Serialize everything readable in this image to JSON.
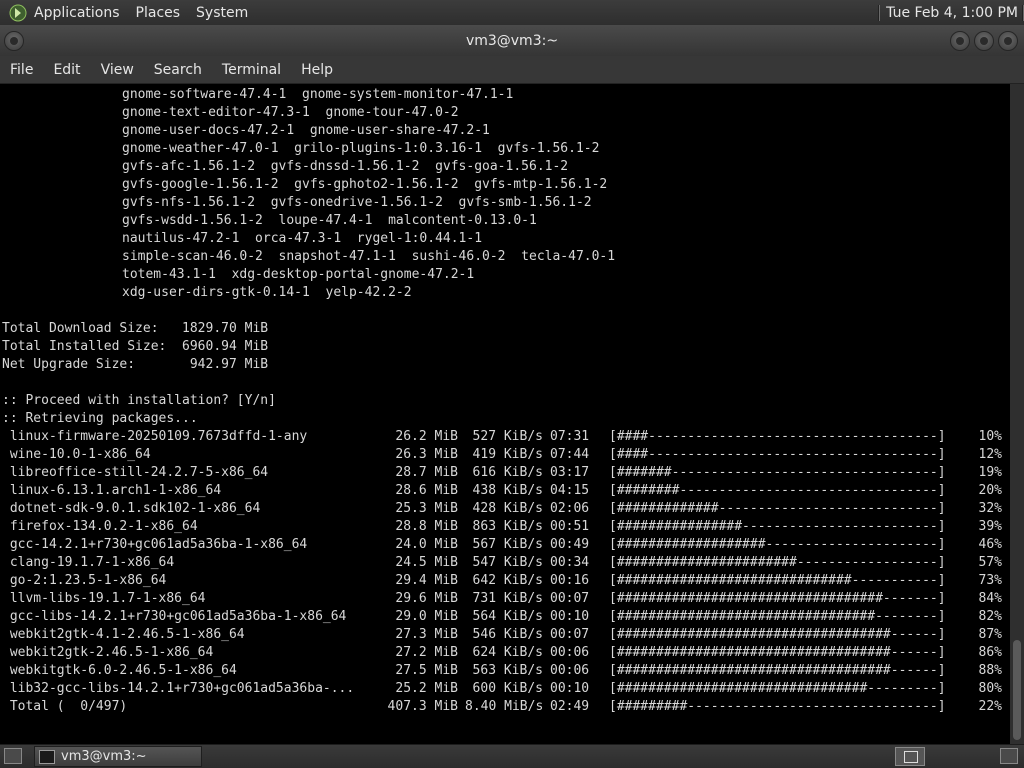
{
  "top_panel": {
    "menus": [
      "Applications",
      "Places",
      "System"
    ],
    "clock": "Tue Feb  4,  1:00 PM"
  },
  "window": {
    "title": "vm3@vm3:~",
    "menu": [
      "File",
      "Edit",
      "View",
      "Search",
      "Terminal",
      "Help"
    ]
  },
  "terminal": {
    "package_lines": [
      "gnome-software-47.4-1  gnome-system-monitor-47.1-1",
      "gnome-text-editor-47.3-1  gnome-tour-47.0-2",
      "gnome-user-docs-47.2-1  gnome-user-share-47.2-1",
      "gnome-weather-47.0-1  grilo-plugins-1:0.3.16-1  gvfs-1.56.1-2",
      "gvfs-afc-1.56.1-2  gvfs-dnssd-1.56.1-2  gvfs-goa-1.56.1-2",
      "gvfs-google-1.56.1-2  gvfs-gphoto2-1.56.1-2  gvfs-mtp-1.56.1-2",
      "gvfs-nfs-1.56.1-2  gvfs-onedrive-1.56.1-2  gvfs-smb-1.56.1-2",
      "gvfs-wsdd-1.56.1-2  loupe-47.4-1  malcontent-0.13.0-1",
      "nautilus-47.2-1  orca-47.3-1  rygel-1:0.44.1-1",
      "simple-scan-46.0-2  snapshot-47.1-1  sushi-46.0-2  tecla-47.0-1",
      "totem-43.1-1  xdg-desktop-portal-gnome-47.2-1",
      "xdg-user-dirs-gtk-0.14-1  yelp-42.2-2"
    ],
    "summary": [
      "Total Download Size:   1829.70 MiB",
      "Total Installed Size:  6960.94 MiB",
      "Net Upgrade Size:       942.97 MiB"
    ],
    "prompt": ":: Proceed with installation? [Y/n]",
    "retrieving": ":: Retrieving packages...",
    "downloads": [
      {
        "name": " linux-firmware-20250109.7673dffd-1-any",
        "size": "26.2 MiB",
        "speed": "527 KiB/s",
        "eta": "07:31",
        "bar": "[####-------------------------------------]",
        "pct": "10%"
      },
      {
        "name": " wine-10.0-1-x86_64",
        "size": "26.3 MiB",
        "speed": "419 KiB/s",
        "eta": "07:44",
        "bar": "[####-------------------------------------]",
        "pct": "12%"
      },
      {
        "name": " libreoffice-still-24.2.7-5-x86_64",
        "size": "28.7 MiB",
        "speed": "616 KiB/s",
        "eta": "03:17",
        "bar": "[#######----------------------------------]",
        "pct": "19%"
      },
      {
        "name": " linux-6.13.1.arch1-1-x86_64",
        "size": "28.6 MiB",
        "speed": "438 KiB/s",
        "eta": "04:15",
        "bar": "[########---------------------------------]",
        "pct": "20%"
      },
      {
        "name": " dotnet-sdk-9.0.1.sdk102-1-x86_64",
        "size": "25.3 MiB",
        "speed": "428 KiB/s",
        "eta": "02:06",
        "bar": "[#############----------------------------]",
        "pct": "32%"
      },
      {
        "name": " firefox-134.0.2-1-x86_64",
        "size": "28.8 MiB",
        "speed": "863 KiB/s",
        "eta": "00:51",
        "bar": "[################-------------------------]",
        "pct": "39%"
      },
      {
        "name": " gcc-14.2.1+r730+gc061ad5a36ba-1-x86_64",
        "size": "24.0 MiB",
        "speed": "567 KiB/s",
        "eta": "00:49",
        "bar": "[###################----------------------]",
        "pct": "46%"
      },
      {
        "name": " clang-19.1.7-1-x86_64",
        "size": "24.5 MiB",
        "speed": "547 KiB/s",
        "eta": "00:34",
        "bar": "[#######################------------------]",
        "pct": "57%"
      },
      {
        "name": " go-2:1.23.5-1-x86_64",
        "size": "29.4 MiB",
        "speed": "642 KiB/s",
        "eta": "00:16",
        "bar": "[##############################-----------]",
        "pct": "73%"
      },
      {
        "name": " llvm-libs-19.1.7-1-x86_64",
        "size": "29.6 MiB",
        "speed": "731 KiB/s",
        "eta": "00:07",
        "bar": "[##################################-------]",
        "pct": "84%"
      },
      {
        "name": " gcc-libs-14.2.1+r730+gc061ad5a36ba-1-x86_64",
        "size": "29.0 MiB",
        "speed": "564 KiB/s",
        "eta": "00:10",
        "bar": "[#################################--------]",
        "pct": "82%"
      },
      {
        "name": " webkit2gtk-4.1-2.46.5-1-x86_64",
        "size": "27.3 MiB",
        "speed": "546 KiB/s",
        "eta": "00:07",
        "bar": "[###################################------]",
        "pct": "87%"
      },
      {
        "name": " webkit2gtk-2.46.5-1-x86_64",
        "size": "27.2 MiB",
        "speed": "624 KiB/s",
        "eta": "00:06",
        "bar": "[###################################------]",
        "pct": "86%"
      },
      {
        "name": " webkitgtk-6.0-2.46.5-1-x86_64",
        "size": "27.5 MiB",
        "speed": "563 KiB/s",
        "eta": "00:06",
        "bar": "[###################################------]",
        "pct": "88%"
      },
      {
        "name": " lib32-gcc-libs-14.2.1+r730+gc061ad5a36ba-...",
        "size": "25.2 MiB",
        "speed": "600 KiB/s",
        "eta": "00:10",
        "bar": "[################################---------]",
        "pct": "80%"
      },
      {
        "name": " Total (  0/497)",
        "size": "407.3 MiB",
        "speed": "8.40 MiB/s",
        "eta": "02:49",
        "bar": "[#########--------------------------------]",
        "pct": "22%"
      }
    ]
  },
  "taskbar": {
    "window_label": "vm3@vm3:~"
  }
}
